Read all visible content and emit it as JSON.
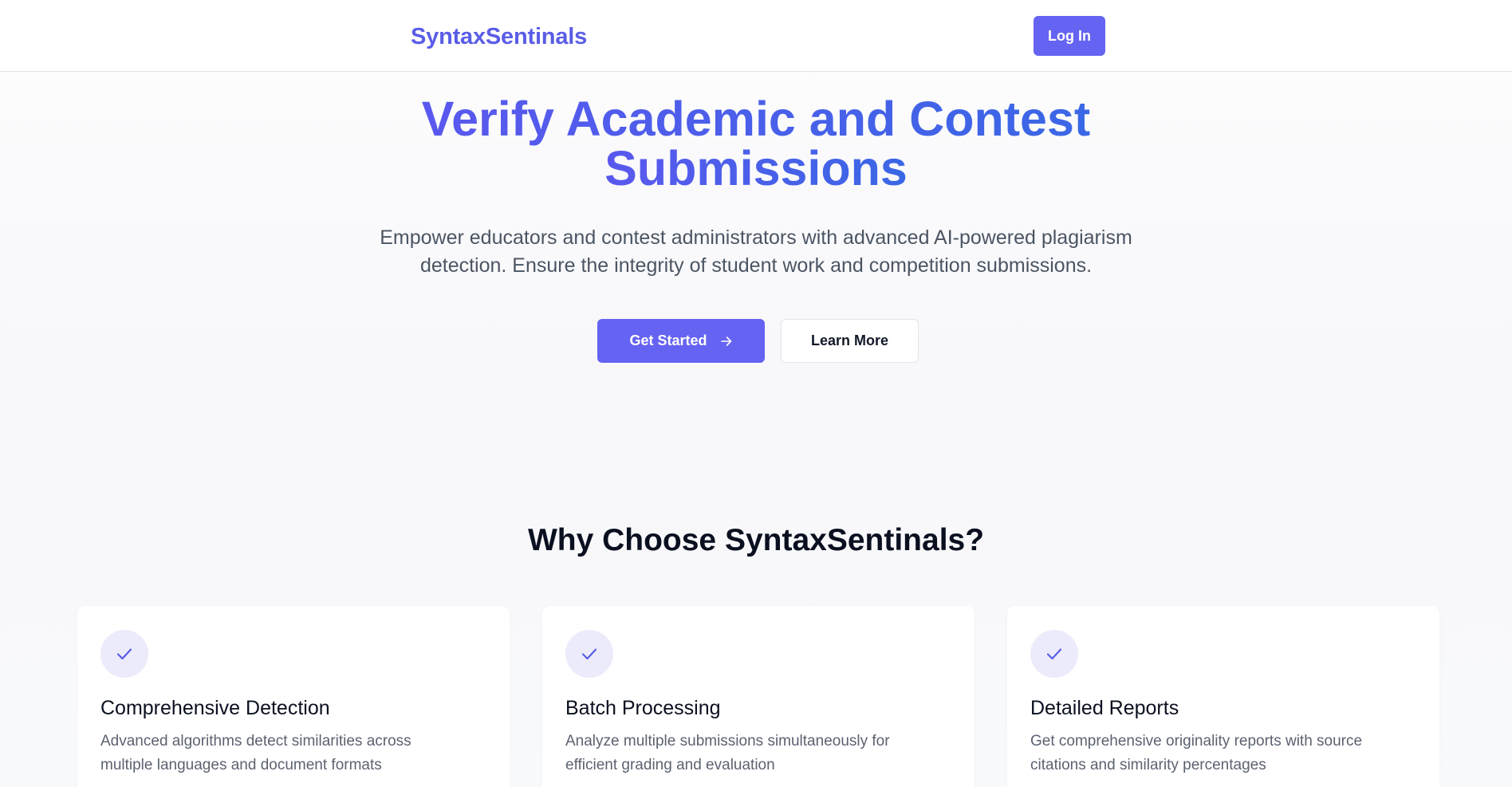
{
  "header": {
    "brand": "SyntaxSentinals",
    "login_label": "Log In"
  },
  "hero": {
    "title_line1": "Verify Academic and Contest",
    "title_line2": "Submissions",
    "subtitle_line1": "Empower educators and contest administrators with advanced AI-powered plagiarism",
    "subtitle_line2": "detection. Ensure the integrity of student work and competition submissions.",
    "primary_cta": "Get Started",
    "secondary_cta": "Learn More"
  },
  "features": {
    "title": "Why Choose SyntaxSentinals?",
    "items": [
      {
        "icon": "check-icon",
        "title": "Comprehensive Detection",
        "desc_line1": "Advanced algorithms detect similarities across",
        "desc_line2": "multiple languages and document formats"
      },
      {
        "icon": "check-icon",
        "title": "Batch Processing",
        "desc_line1": "Analyze multiple submissions simultaneously for",
        "desc_line2": "efficient grading and evaluation"
      },
      {
        "icon": "check-icon",
        "title": "Detailed Reports",
        "desc_line1": "Get comprehensive originality reports with source",
        "desc_line2": "citations and similarity percentages"
      }
    ]
  },
  "colors": {
    "brand": "#5a5de6",
    "primary_button": "#6563f1",
    "hero_gradient_start": "#5a58ee",
    "hero_gradient_end": "#3a67e5",
    "icon_bg": "#ecebfb"
  }
}
